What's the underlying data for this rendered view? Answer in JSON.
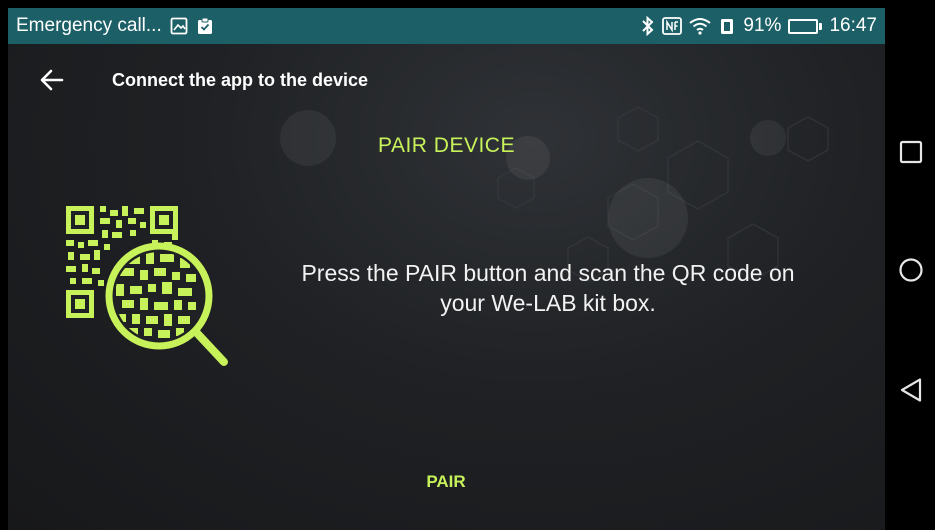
{
  "status_bar": {
    "notification_text": "Emergency call...",
    "battery_percent": "91%",
    "battery_level": 0.91,
    "time": "16:47",
    "icons": [
      "gallery-icon",
      "clipboard-icon",
      "bluetooth-icon",
      "nfc-icon",
      "wifi-icon",
      "vibrate-icon",
      "battery-icon"
    ]
  },
  "header": {
    "title": "Connect the app to the device",
    "back_icon": "arrow-left-icon"
  },
  "main": {
    "section_title": "PAIR DEVICE",
    "instructions_line1": "Press the PAIR button and scan the QR code on",
    "instructions_line2": "your We-LAB kit box.",
    "illustration": "qr-magnifier-icon",
    "pair_label": "PAIR"
  },
  "nav_bar": {
    "icons": [
      "recents-square-icon",
      "home-circle-icon",
      "back-triangle-icon"
    ]
  },
  "colors": {
    "accent": "#c8f25a",
    "status_bar": "#1c5f66",
    "background": "#1f2124",
    "text": "#f2f2f2"
  }
}
